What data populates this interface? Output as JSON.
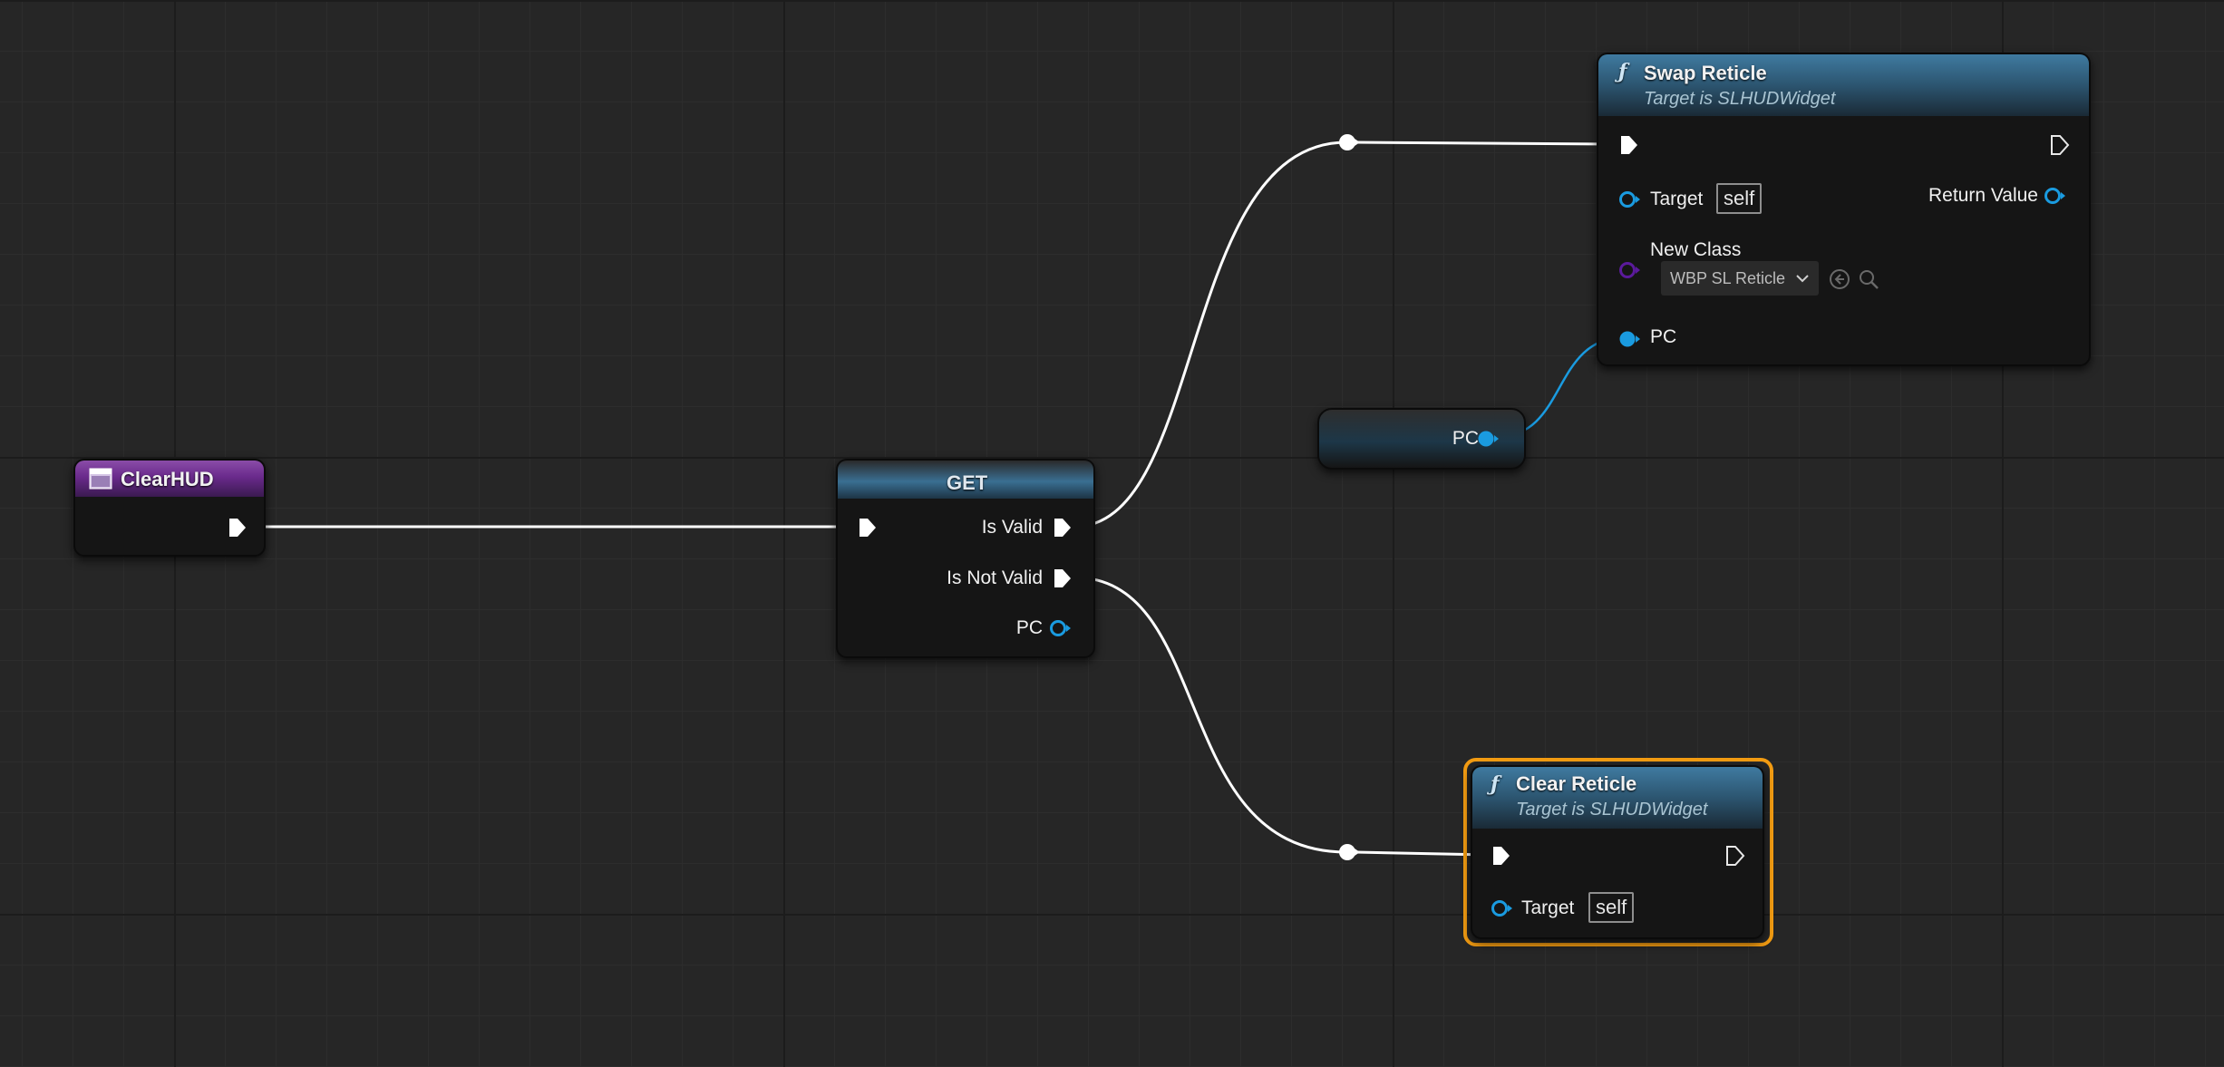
{
  "nodes": {
    "clear_hud": {
      "title": "ClearHUD"
    },
    "get": {
      "title": "GET",
      "is_valid": "Is Valid",
      "is_not_valid": "Is Not Valid",
      "pc": "PC"
    },
    "swap_reticle": {
      "title": "Swap Reticle",
      "subtitle": "Target is SLHUDWidget",
      "target": "Target",
      "target_value": "self",
      "return_value": "Return Value",
      "new_class": "New Class",
      "new_class_value": "WBP SL Reticle",
      "pc": "PC"
    },
    "pc_var": {
      "label": "PC"
    },
    "clear_reticle": {
      "title": "Clear Reticle",
      "subtitle": "Target is SLHUDWidget",
      "target": "Target",
      "target_value": "self"
    }
  },
  "colors": {
    "exec_wire": "#ffffff",
    "object_pin": "#1a9be0",
    "class_pin": "#5b1a9c",
    "selection": "#f39c12",
    "event_header": "#7a3a9c",
    "function_header": "#2c5570"
  },
  "icons": {
    "function": "function-f-icon",
    "event": "event-window-icon",
    "use_selected": "arrow-left-circle-icon",
    "browse": "magnifier-icon",
    "dropdown": "chevron-down-icon"
  }
}
